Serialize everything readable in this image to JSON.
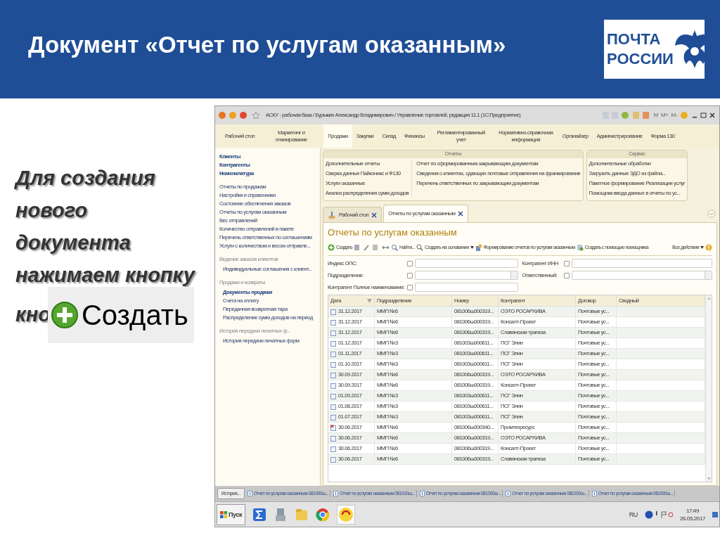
{
  "slide": {
    "title": "Документ «Отчет по услугам оказанным»",
    "logo_lines": [
      "ПОЧТА",
      "РОССИИ"
    ],
    "instruction": "Для создания нового документа нажимаем кнопку",
    "covered_text": "кно",
    "button_image_label": "Создать"
  },
  "window": {
    "title": "АСКУ - рабочая база / Бурыкин Александр Владимирович / Управление торговлей, редакция 11.1  (1С:Предприятие)",
    "memory_buttons": [
      "M",
      "M+",
      "M-"
    ]
  },
  "sections": [
    {
      "label": "Рабочий стол",
      "selected": false
    },
    {
      "label": "Маркетинг и планирование",
      "selected": false
    },
    {
      "label": "Продажи",
      "selected": true
    },
    {
      "label": "Закупки",
      "selected": false
    },
    {
      "label": "Склад",
      "selected": false
    },
    {
      "label": "Финансы",
      "selected": false
    },
    {
      "label": "Регламентированный учет",
      "selected": false
    },
    {
      "label": "Нормативно-справочная информация",
      "selected": false
    },
    {
      "label": "Органайзер",
      "selected": false
    },
    {
      "label": "Администрирование",
      "selected": false
    },
    {
      "label": "Форма 130",
      "selected": false
    }
  ],
  "sidebar": {
    "groups": [
      {
        "items": [
          {
            "label": "Клиенты",
            "emphasized": true
          },
          {
            "label": "Контрагенты",
            "emphasized": true
          },
          {
            "label": "Номенклатура",
            "emphasized": true
          }
        ]
      },
      {
        "items": [
          {
            "label": "Отчеты по продажам",
            "emphasized": false
          },
          {
            "label": "Настройки и справочники",
            "emphasized": false
          },
          {
            "label": "Состояние обеспечения заказов",
            "emphasized": false
          },
          {
            "label": "Отчеты по услугам оказанным",
            "emphasized": false
          },
          {
            "label": "Вес отправлений",
            "emphasized": false
          },
          {
            "label": "Количество отправлений в пакете",
            "emphasized": false
          },
          {
            "label": "Перечень ответственных по соглашениям",
            "emphasized": false
          },
          {
            "label": "Услуги с количеством и весом отправле...",
            "emphasized": false
          }
        ]
      },
      {
        "heading": "Ведение заказов клиентов",
        "items": [
          {
            "label": "Индивидуальные соглашения с клиент...",
            "emphasized": false
          }
        ]
      },
      {
        "heading": "Продажи и возвраты",
        "items": [
          {
            "label": "Документы продажи",
            "emphasized": true
          },
          {
            "label": "Счета на оплату",
            "emphasized": false
          },
          {
            "label": "Переданная возвратная тара",
            "emphasized": false
          },
          {
            "label": "Распределение сумм доходов на период",
            "emphasized": false
          }
        ]
      },
      {
        "heading": "История передачи печатных ф...",
        "items": [
          {
            "label": "История передачи печатных форм",
            "emphasized": false
          }
        ]
      }
    ]
  },
  "reports_panel": {
    "title": "Отчеты",
    "columns": [
      [
        "Дополнительные отчеты",
        "Сверка данных Пайконикс и Ф130",
        "Услуги оказанные",
        "Анализ распределения сумм доходов"
      ],
      [
        "Отчет по сформированным закрывающим документам",
        "Сведения о клиентах, сдающих почтовые отправления на франкирование",
        "Перечень ответственных по закрывающим документам"
      ]
    ]
  },
  "service_panel": {
    "title": "Сервис",
    "items": [
      "Дополнительные обработки",
      "Загрузить данные ЭДО из файла...",
      "Пакетное формирование Реализации услуг",
      "Помощник ввода данных в отчеты по ус..."
    ]
  },
  "open_tabs": [
    {
      "label": "Рабочий стол",
      "selected": false
    },
    {
      "label": "Отчеты по услугам оказанным",
      "selected": true
    }
  ],
  "form": {
    "title": "Отчеты по услугам оказанным",
    "toolbar": [
      "Создать",
      "Найти...",
      "Создать на основании",
      "Формирование отчетов по услугам оказанным",
      "Создать с помощью помощника"
    ],
    "all_actions": "Все действия",
    "filters": [
      {
        "label": "Индекс ОПС:",
        "checked": false,
        "picker": false
      },
      {
        "label": "Подразделение:",
        "checked": false,
        "picker": true
      },
      {
        "label": "Контрагент Полное наименование:",
        "checked": false,
        "picker": false
      },
      {
        "label": "Контрагент ИНН",
        "checked": false,
        "picker": false
      },
      {
        "label": "Ответственный:",
        "checked": false,
        "picker": true
      }
    ],
    "table": {
      "columns": [
        "Дата",
        "Подразделение",
        "Номер",
        "Контрагент",
        "Договор",
        "Сводный"
      ],
      "rows": [
        {
          "cells": [
            "31.12.2017",
            "ММП №6",
            "081006ш000319...",
            "ОЭТО РОСАРХИВА",
            "Почтовые ус..."
          ],
          "deletion_mark": false
        },
        {
          "cells": [
            "31.12.2017",
            "ММП №6",
            "081006ш000319...",
            "Консалт-Проект",
            "Почтовые ус..."
          ],
          "deletion_mark": false
        },
        {
          "cells": [
            "31.12.2017",
            "ММП №6",
            "081006ш000319...",
            "Славянская трапеза",
            "Почтовые ус..."
          ],
          "deletion_mark": false
        },
        {
          "cells": [
            "01.12.2017",
            "ММП №3",
            "081003ш000611...",
            "ПСГ Элин",
            "Почтовые ус..."
          ],
          "deletion_mark": false
        },
        {
          "cells": [
            "01.11.2017",
            "ММП №3",
            "081003ш000611...",
            "ПСГ Элин",
            "Почтовые ус..."
          ],
          "deletion_mark": false
        },
        {
          "cells": [
            "01.10.2017",
            "ММП №3",
            "081003ш000611...",
            "ПСГ Элин",
            "Почтовые ус..."
          ],
          "deletion_mark": false
        },
        {
          "cells": [
            "30.09.2017",
            "ММП №6",
            "081006ш000319...",
            "ОЭТО РОСАРХИВА",
            "Почтовые ус..."
          ],
          "deletion_mark": false
        },
        {
          "cells": [
            "30.09.2017",
            "ММП №6",
            "081006ш000319...",
            "Консалт-Проект",
            "Почтовые ус..."
          ],
          "deletion_mark": false
        },
        {
          "cells": [
            "01.09.2017",
            "ММП №3",
            "081003ш000611...",
            "ПСГ Элин",
            "Почтовые ус..."
          ],
          "deletion_mark": false
        },
        {
          "cells": [
            "01.08.2017",
            "ММП №3",
            "081003ш000611...",
            "ПСГ Элин",
            "Почтовые ус..."
          ],
          "deletion_mark": false
        },
        {
          "cells": [
            "01.07.2017",
            "ММП №3",
            "081003ш000611...",
            "ПСГ Элин",
            "Почтовые ус..."
          ],
          "deletion_mark": false
        },
        {
          "cells": [
            "30.06.2017",
            "ММП №6",
            "081006ш000340...",
            "Промтехресурс",
            "Почтовые ус..."
          ],
          "deletion_mark": true
        },
        {
          "cells": [
            "30.06.2017",
            "ММП №6",
            "081006ш000319...",
            "ОЭТО РОСАРХИВА",
            "Почтовые ус..."
          ],
          "deletion_mark": false
        },
        {
          "cells": [
            "30.06.2017",
            "ММП №6",
            "081006ш000319...",
            "Консалт-Проект",
            "Почтовые ус..."
          ],
          "deletion_mark": false
        },
        {
          "cells": [
            "30.06.2017",
            "ММП №6",
            "081006ш000319...",
            "Славянская трапеза",
            "Почтовые ус..."
          ],
          "deletion_mark": false
        }
      ]
    }
  },
  "history_bar": {
    "button": "История...",
    "items": [
      "Отчет по услугам оказанным 081000ш...",
      "Отчет по услугам оказанным 081000ш...",
      "Отчет по услугам оказанным 081000ш...",
      "Отчет по услугам оказанным 081000ш...",
      "Отчет по услугам оказанным 081000ш..."
    ]
  },
  "taskbar": {
    "start": "Пуск",
    "language": "RU",
    "time": "17:49",
    "date": "26.05.2017"
  }
}
